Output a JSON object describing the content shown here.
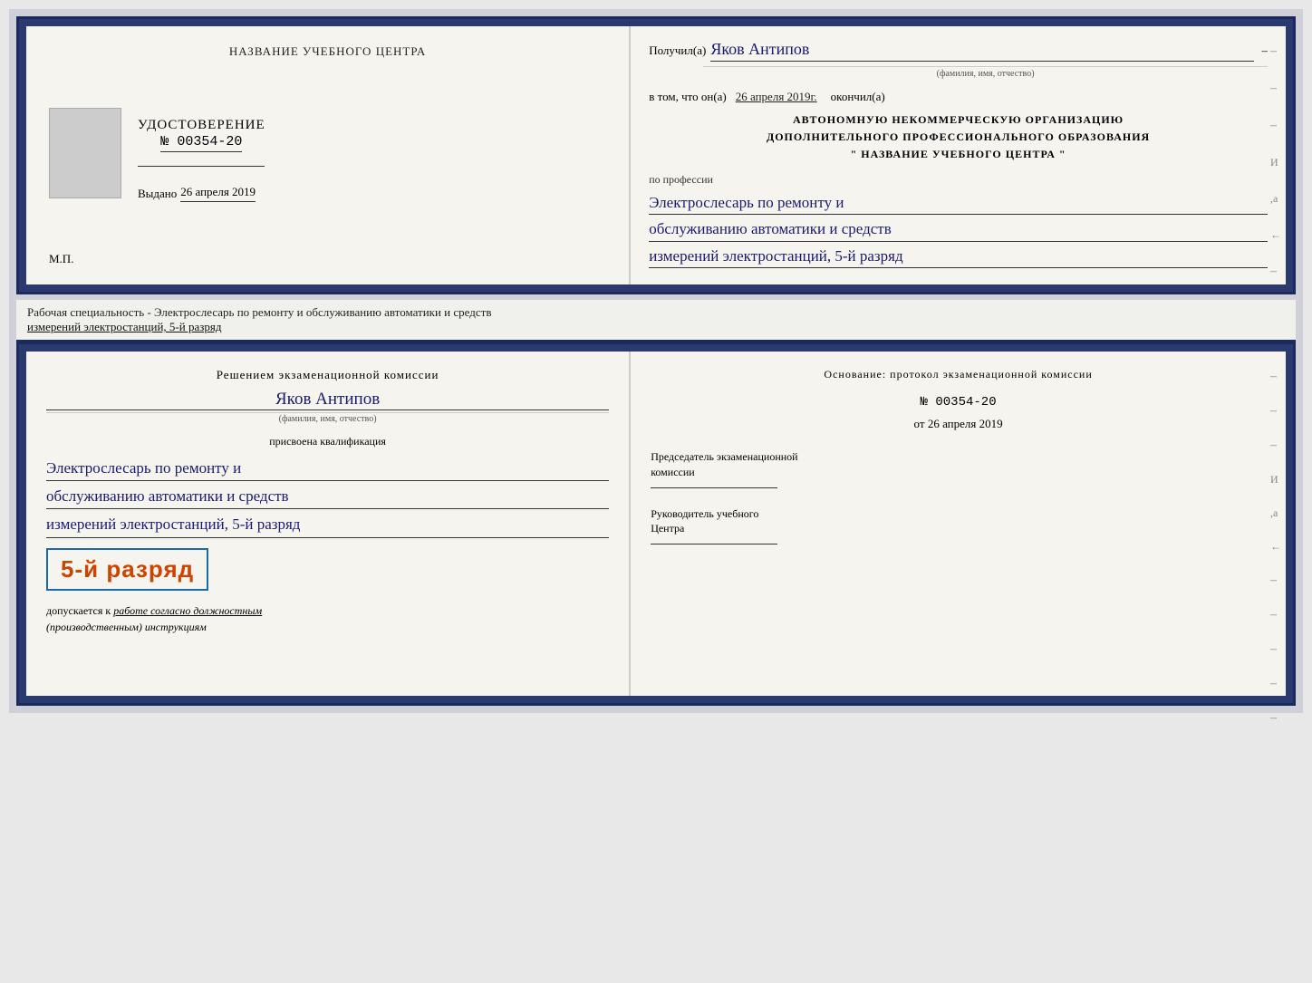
{
  "topLeft": {
    "schoolName": "НАЗВАНИЕ УЧЕБНОГО ЦЕНТРА",
    "certTitle": "УДОСТОВЕРЕНИЕ",
    "certNumber": "№ 00354-20",
    "issuedLabel": "Выдано",
    "issuedDate": "26 апреля 2019",
    "mpLabel": "М.П."
  },
  "topRight": {
    "receivedLabel": "Получил(а)",
    "receivedName": "Яков Антипов",
    "fioSub": "(фамилия, имя, отчество)",
    "vtomLabel": "в том, что он(а)",
    "vtomDate": "26 апреля 2019г.",
    "okonchill": "окончил(а)",
    "orgLine1": "АВТОНОМНУЮ НЕКОММЕРЧЕСКУЮ ОРГАНИЗАЦИЮ",
    "orgLine2": "ДОПОЛНИТЕЛЬНОГО ПРОФЕССИОНАЛЬНОГО ОБРАЗОВАНИЯ",
    "orgLine3": "\"   НАЗВАНИЕ УЧЕБНОГО ЦЕНТРА   \"",
    "poProfessii": "по профессии",
    "profLine1": "Электрослесарь по ремонту и",
    "profLine2": "обслуживанию автоматики и средств",
    "profLine3": "измерений электростанций, 5-й разряд"
  },
  "middleText": "Рабочая специальность - Электрослесарь по ремонту и обслуживанию автоматики и средств",
  "middleText2": "измерений электростанций, 5-й разряд",
  "bottomLeft": {
    "commissionTitle": "Решением экзаменационной комиссии",
    "personName": "Яков Антипов",
    "fioSub": "(фамилия, имя, отчество)",
    "prisvoena": "присвоена квалификация",
    "qualLine1": "Электрослесарь по ремонту и",
    "qualLine2": "обслуживанию автоматики и средств",
    "qualLine3": "измерений электростанций, 5-й разряд",
    "razryadBadge": "5-й разряд",
    "dopuskaetsyaLabel": "допускается к",
    "workText": "работе согласно должностным",
    "instrText": "(производственным) инструкциям"
  },
  "bottomRight": {
    "osnovanie": "Основание: протокол экзаменационной комиссии",
    "protocolNumber": "№  00354-20",
    "otLabel": "от",
    "otDate": "26 апреля 2019",
    "chairmanLine1": "Председатель экзаменационной",
    "chairmanLine2": "комиссии",
    "rukovoditelLine1": "Руководитель учебного",
    "rukovoditelLine2": "Центра"
  },
  "decorations": {
    "dashItems": [
      "-",
      "-",
      "-",
      "И",
      ",а",
      "←",
      "-",
      "-",
      "-",
      "-",
      "-"
    ]
  }
}
